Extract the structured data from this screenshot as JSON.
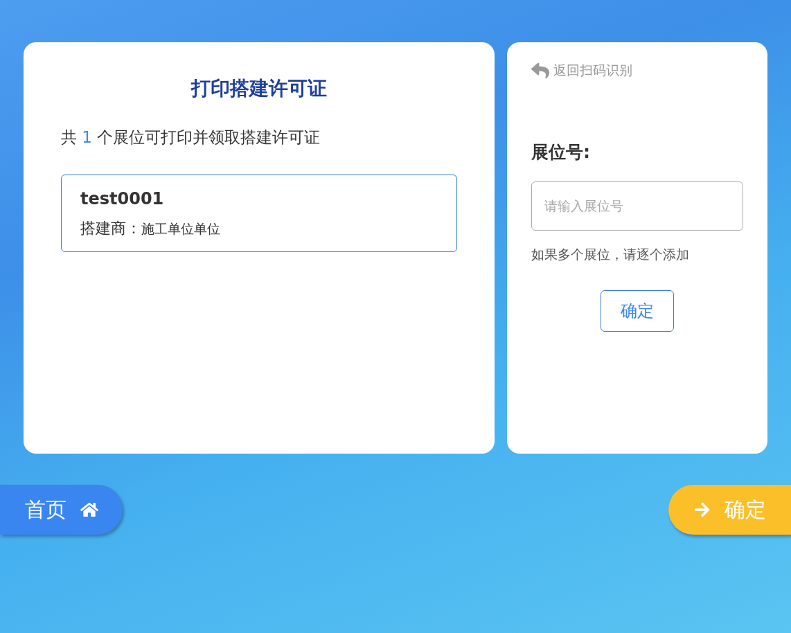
{
  "left": {
    "title": "打印搭建许可证",
    "summary": {
      "prefix": "共",
      "count": "1",
      "suffix": "个展位可打印并领取搭建许可证"
    },
    "booths": [
      {
        "number": "test0001",
        "builder_label": "搭建商：",
        "builder": "施工单位单位"
      }
    ]
  },
  "right": {
    "back": "返回扫码识别",
    "field_label": "展位号:",
    "placeholder": "请输入展位号",
    "hint": "如果多个展位，请逐个添加",
    "confirm": "确定"
  },
  "footer": {
    "home": "首页",
    "next": "确定"
  }
}
